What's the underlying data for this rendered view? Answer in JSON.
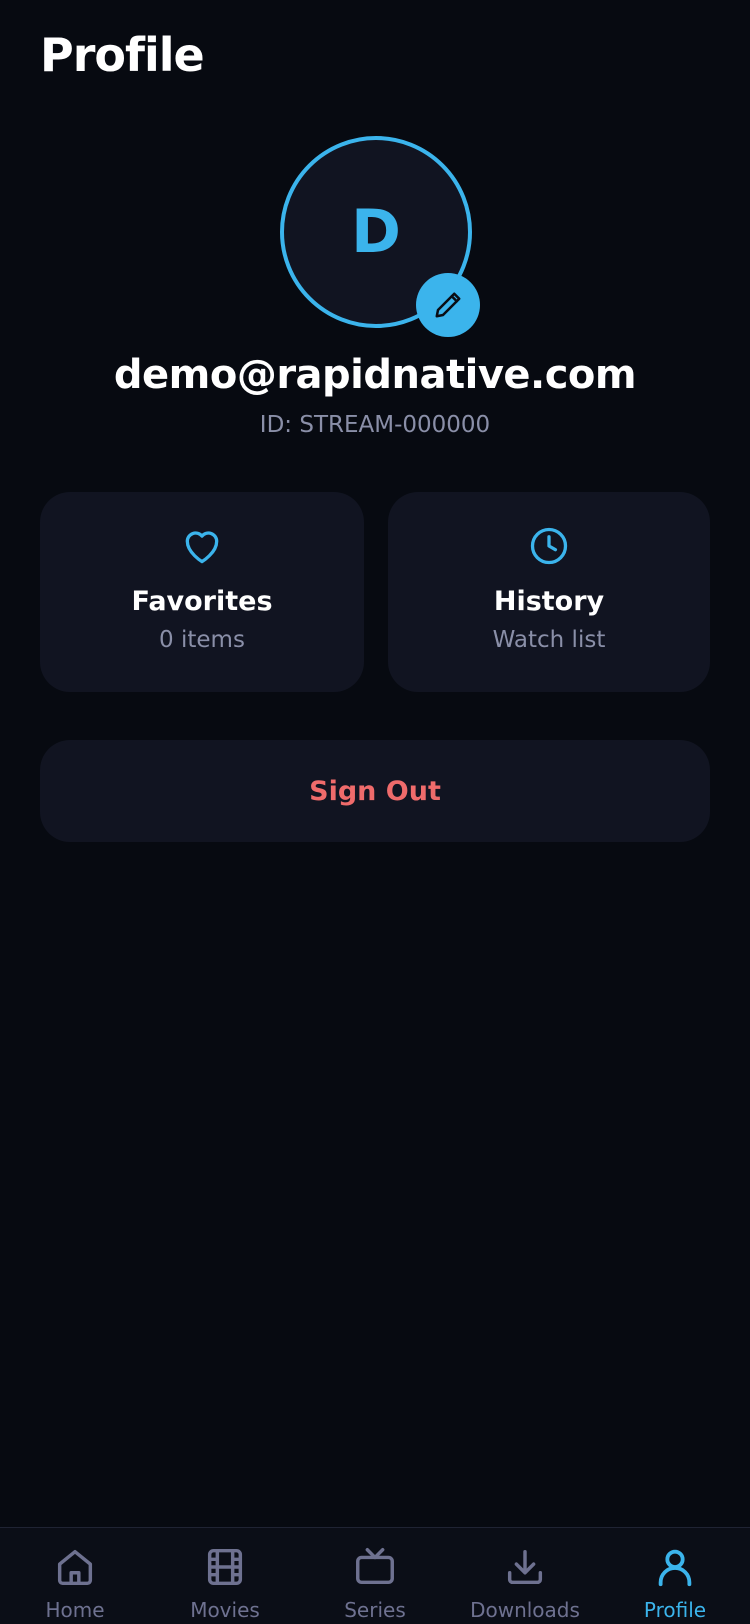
{
  "header": {
    "title": "Profile"
  },
  "avatar": {
    "initial": "D",
    "edit_icon": "pencil-icon"
  },
  "user": {
    "email": "demo@rapidnative.com",
    "id_text": "ID: STREAM-000000"
  },
  "cards": [
    {
      "icon": "heart-icon",
      "title": "Favorites",
      "subtitle": "0 items"
    },
    {
      "icon": "clock-icon",
      "title": "History",
      "subtitle": "Watch list"
    }
  ],
  "actions": {
    "sign_out_label": "Sign Out"
  },
  "tabs": [
    {
      "icon": "home-icon",
      "label": "Home",
      "active": false
    },
    {
      "icon": "film-icon",
      "label": "Movies",
      "active": false
    },
    {
      "icon": "tv-icon",
      "label": "Series",
      "active": false
    },
    {
      "icon": "download-icon",
      "label": "Downloads",
      "active": false
    },
    {
      "icon": "user-icon",
      "label": "Profile",
      "active": true
    }
  ],
  "colors": {
    "background": "#070a11",
    "surface": "#111421",
    "accent": "#3bb4ec",
    "danger": "#ef6b6b",
    "muted": "#8a8fa8",
    "tab_inactive": "#6e7190"
  }
}
